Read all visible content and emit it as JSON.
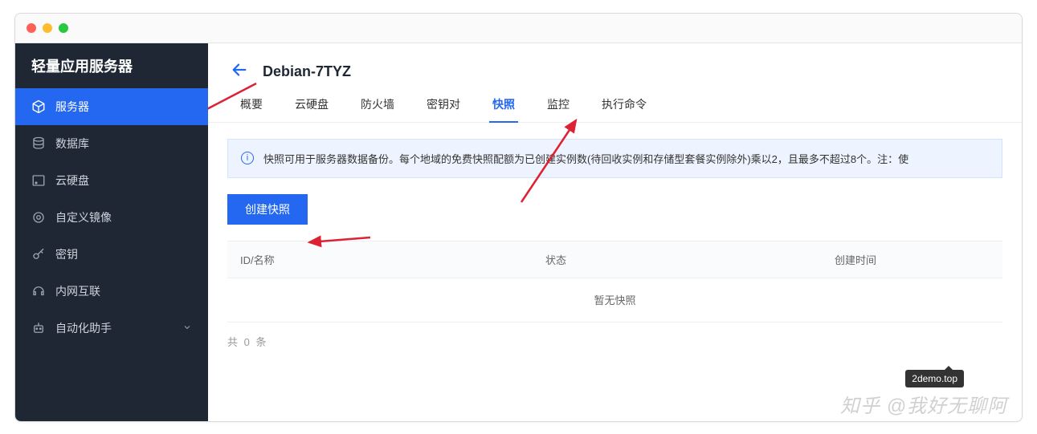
{
  "brand": "轻量应用服务器",
  "sidebar": {
    "items": [
      {
        "label": "服务器",
        "icon": "cube"
      },
      {
        "label": "数据库",
        "icon": "database"
      },
      {
        "label": "云硬盘",
        "icon": "disk"
      },
      {
        "label": "自定义镜像",
        "icon": "target"
      },
      {
        "label": "密钥",
        "icon": "key"
      },
      {
        "label": "内网互联",
        "icon": "headset"
      },
      {
        "label": "自动化助手",
        "icon": "robot",
        "expandable": true
      }
    ],
    "active_index": 0
  },
  "header": {
    "title": "Debian-7TYZ"
  },
  "tabs": {
    "items": [
      "概要",
      "云硬盘",
      "防火墙",
      "密钥对",
      "快照",
      "监控",
      "执行命令"
    ],
    "active_index": 4
  },
  "info": {
    "text": "快照可用于服务器数据备份。每个地域的免费快照配额为已创建实例数(待回收实例和存储型套餐实例除外)乘以2，且最多不超过8个。注：使"
  },
  "actions": {
    "create_snapshot": "创建快照"
  },
  "table": {
    "columns": [
      "ID/名称",
      "状态",
      "创建时间"
    ],
    "empty_text": "暂无快照"
  },
  "pager": {
    "prefix": "共",
    "count": "0",
    "suffix": "条"
  },
  "tooltip": "2demo.top",
  "watermark": "知乎 @我好无聊阿"
}
